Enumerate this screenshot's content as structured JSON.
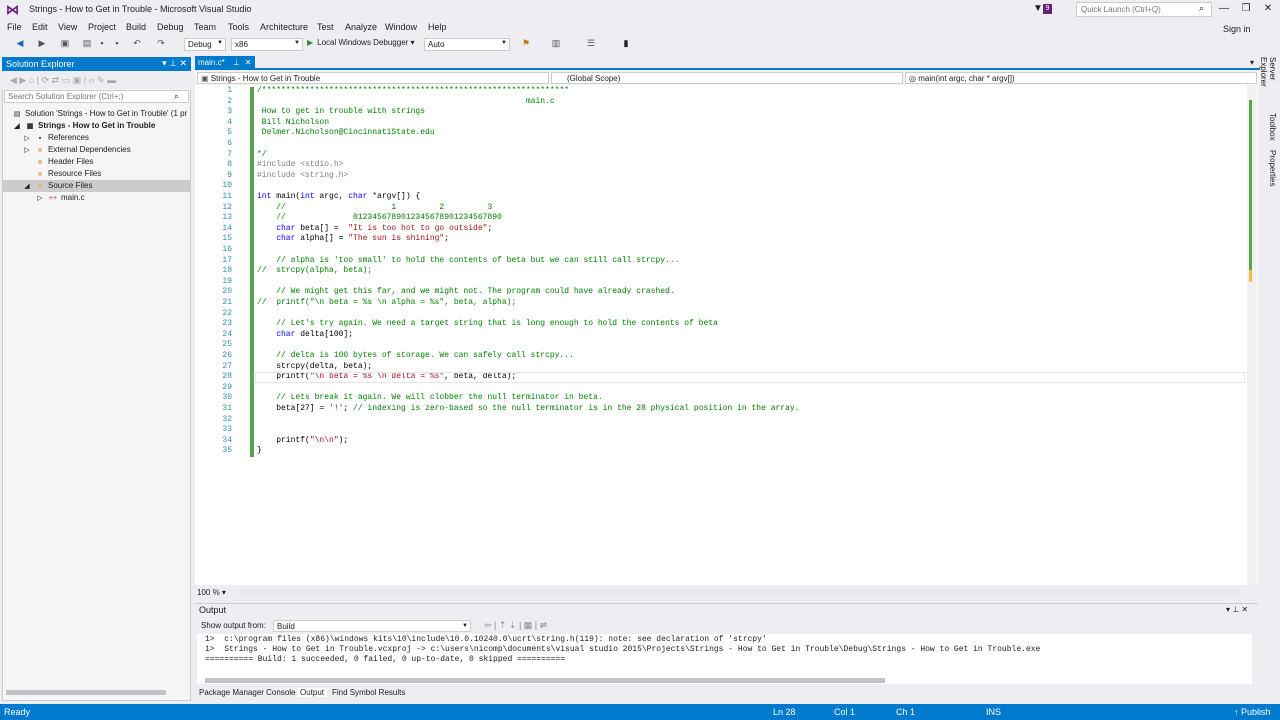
{
  "window": {
    "title": "Strings - How to Get in Trouble - Microsoft Visual Studio",
    "notification_count": "9",
    "quick_launch_placeholder": "Quick Launch (Ctrl+Q)"
  },
  "menu": [
    "File",
    "Edit",
    "View",
    "Project",
    "Build",
    "Debug",
    "Team",
    "Tools",
    "Architecture",
    "Test",
    "Analyze",
    "Window",
    "Help"
  ],
  "signin": "Sign in",
  "toolbar": {
    "config": "Debug",
    "platform": "x86",
    "debugger": "Local Windows Debugger",
    "target": "Auto"
  },
  "solution_explorer": {
    "title": "Solution Explorer",
    "search_placeholder": "Search Solution Explorer (Ctrl+;)",
    "items": [
      {
        "label": "Solution 'Strings - How to Get in Trouble' (1 pr",
        "depth": 0
      },
      {
        "label": "Strings - How to Get in Trouble",
        "depth": 1
      },
      {
        "label": "References",
        "depth": 2
      },
      {
        "label": "External Dependencies",
        "depth": 2
      },
      {
        "label": "Header Files",
        "depth": 2
      },
      {
        "label": "Resource Files",
        "depth": 2
      },
      {
        "label": "Source Files",
        "depth": 2
      },
      {
        "label": "main.c",
        "depth": 3
      }
    ]
  },
  "editor": {
    "tab": "main.c*",
    "nav_project": "Strings - How to Get in Trouble",
    "nav_scope": "(Global Scope)",
    "nav_function": "main(int argc, char * argv[])",
    "zoom": "100 %",
    "lines": [
      "/****************************************************************",
      "                                                        main.c",
      " How to get in trouble with strings",
      " Bill Nicholson",
      " Delmer.Nicholson@CincinnatiState.edu",
      "",
      "*/",
      "#include <stdio.h>",
      "#include <string.h>",
      "",
      "int main(int argc, char *argv[]) {",
      "    //                      1         2         3",
      "    //              0123456789012345678901234567890",
      "    char beta[] =  \"It is too hot to go outside\";",
      "    char alpha[] = \"The sun is shining\";",
      "",
      "    // alpha is 'too small' to hold the contents of beta but we can still call strcpy...",
      "//  strcpy(alpha, beta);",
      "",
      "    // We might get this far, and we might not. The program could have already crashed.",
      "//  printf(\"\\n beta = %s \\n alpha = %s\", beta, alpha);",
      "",
      "    // Let's try again. We need a target string that is long enough to hold the contents of beta",
      "    char delta[100];",
      "",
      "    // delta is 100 bytes of storage. We can safely call strcpy...",
      "    strcpy(delta, beta);",
      "    printf(\"\\n beta = %s \\n delta = %s\", beta, delta);",
      "",
      "    // Lets break it again. We will clobber the null terminator in beta.",
      "    beta[27] = '!'; // indexing is zero-based so the null terminator is in the 28 physical position in the array.",
      "",
      "",
      "    printf(\"\\n\\n\");",
      "}"
    ]
  },
  "output": {
    "title": "Output",
    "show_from_label": "Show output from:",
    "source": "Build",
    "lines": [
      "1>  c:\\program files (x86)\\windows kits\\10\\include\\10.0.10240.0\\ucrt\\string.h(119): note: see declaration of 'strcpy'",
      "1>  Strings - How to Get in Trouble.vcxproj -> c:\\users\\nicomp\\documents\\visual studio 2015\\Projects\\Strings - How to Get in Trouble\\Debug\\Strings - How to Get in Trouble.exe",
      "========== Build: 1 succeeded, 0 failed, 0 up-to-date, 0 skipped =========="
    ],
    "tabs": [
      "Package Manager Console",
      "Output",
      "Find Symbol Results"
    ]
  },
  "side_tabs": [
    "Server Explorer",
    "Toolbox",
    "Properties"
  ],
  "status": {
    "state": "Ready",
    "ln": "Ln 28",
    "col": "Col 1",
    "ch": "Ch 1",
    "mode": "INS",
    "publish": "Publish"
  }
}
